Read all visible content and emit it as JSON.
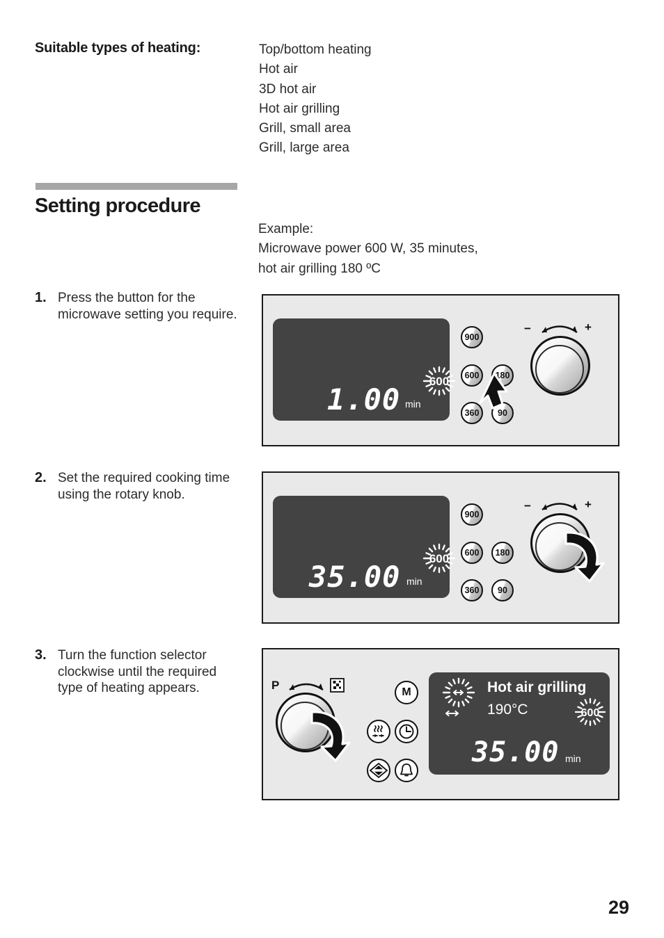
{
  "heating": {
    "label": "Suitable types of heating:",
    "types": [
      "Top/bottom heating",
      "Hot air",
      "3D hot air",
      "Hot air grilling",
      "Grill, small area",
      "Grill, large area"
    ]
  },
  "section": {
    "title": "Setting procedure"
  },
  "example": {
    "line1": "Example:",
    "line2": "Microwave power 600 W, 35 minutes,",
    "line3": "hot air grilling 180 ºC"
  },
  "steps": [
    {
      "number": "1.",
      "text": "Press the button for the microwave setting you require."
    },
    {
      "number": "2.",
      "text": "Set the required cooking time using the rotary knob."
    },
    {
      "number": "3.",
      "text": "Turn the function selector clockwise until the required type of heating appears."
    }
  ],
  "panel1": {
    "display": {
      "time": "1.00",
      "unit": "min",
      "blink_power": "600"
    },
    "buttons": [
      "900",
      "600",
      "180",
      "360",
      "90"
    ],
    "knob": {
      "minus": "−",
      "plus": "+"
    }
  },
  "panel2": {
    "display": {
      "time": "35.00",
      "unit": "min",
      "blink_power": "600"
    },
    "buttons": [
      "900",
      "600",
      "180",
      "360",
      "90"
    ],
    "knob": {
      "minus": "−",
      "plus": "+"
    }
  },
  "panel3": {
    "display": {
      "mode": "Hot air grilling",
      "temperature": "190°C",
      "time": "35.00",
      "unit": "min",
      "blink_power": "600"
    },
    "selector": {
      "left_label": "P",
      "right_label": "microwave-symbol"
    },
    "function_buttons": [
      "M",
      "heating-mode-icon",
      "clock-icon",
      "updown-icon",
      "bell-icon"
    ]
  },
  "footer": {
    "page_number": "29"
  },
  "colors": {
    "panel_bg": "#e9e9e9",
    "screen_bg": "#434343",
    "rule_gray": "#a6a6a6",
    "text": "#1a1a1a"
  }
}
